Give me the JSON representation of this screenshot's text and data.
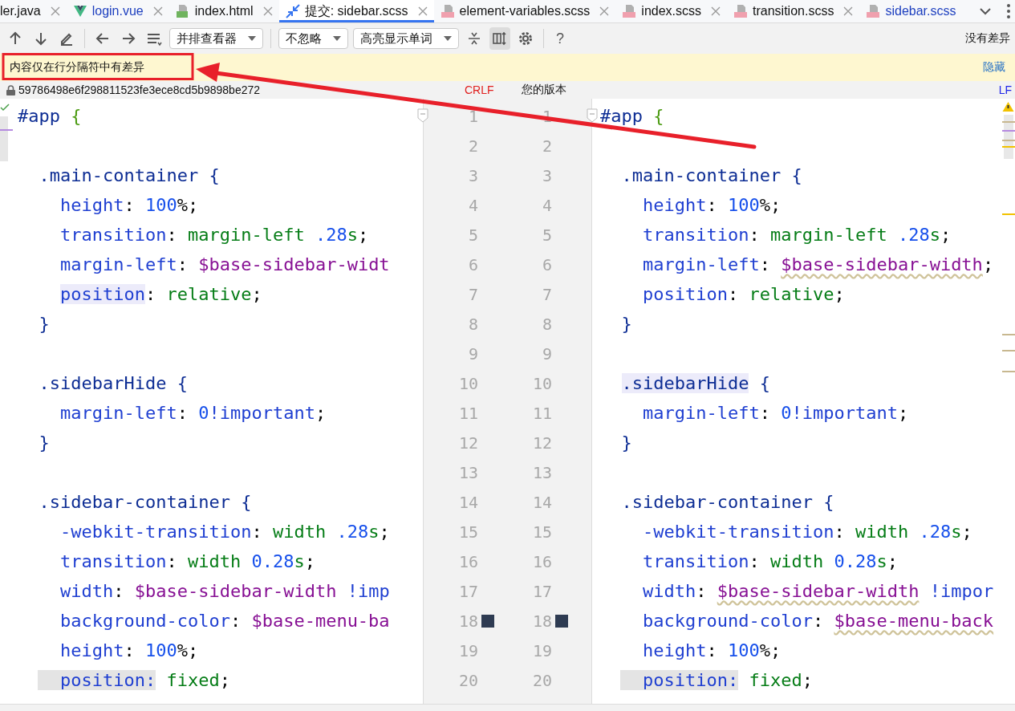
{
  "tabs": [
    {
      "label": "ler.java",
      "kind": "plain",
      "modified": false,
      "selected": false,
      "closable": true
    },
    {
      "label": "login.vue",
      "kind": "vue",
      "modified": true,
      "selected": false,
      "closable": true
    },
    {
      "label": "index.html",
      "kind": "html",
      "modified": false,
      "selected": false,
      "closable": true
    },
    {
      "label": "提交: sidebar.scss",
      "kind": "diff",
      "modified": false,
      "selected": true,
      "closable": true
    },
    {
      "label": "element-variables.scss",
      "kind": "sass",
      "modified": false,
      "selected": false,
      "closable": true
    },
    {
      "label": "index.scss",
      "kind": "sass",
      "modified": false,
      "selected": false,
      "closable": true
    },
    {
      "label": "transition.scss",
      "kind": "sass",
      "modified": false,
      "selected": false,
      "closable": true
    },
    {
      "label": "sidebar.scss",
      "kind": "sass",
      "modified": true,
      "selected": false,
      "closable": false
    }
  ],
  "toolbar": {
    "items": [
      {
        "kind": "up"
      },
      {
        "kind": "down"
      },
      {
        "kind": "edit"
      },
      {
        "kind": "separator"
      },
      {
        "kind": "back"
      },
      {
        "kind": "forward"
      },
      {
        "kind": "menu"
      },
      {
        "kind": "dropdown",
        "label": "并排查看器"
      },
      {
        "kind": "separator"
      },
      {
        "kind": "dropdown",
        "label": "不忽略"
      },
      {
        "kind": "dropdown",
        "label": "高亮显示单词"
      },
      {
        "kind": "collapse"
      },
      {
        "kind": "columns",
        "selected": true
      },
      {
        "kind": "settings"
      },
      {
        "kind": "separator"
      },
      {
        "kind": "help",
        "label": "?"
      }
    ],
    "status": "没有差异"
  },
  "notice": {
    "text": "内容仅在行分隔符中有差异",
    "hide_link": "隐藏"
  },
  "header": {
    "left_revision": "59786498e6f298811523fe3ece8cd5b9898be272",
    "left_separator": "CRLF",
    "right_title": "您的版本",
    "right_separator": "LF"
  },
  "lines": [
    {
      "left_number": "1",
      "right_number": "1",
      "kind": "top",
      "left": [
        {
          "t": "#app ",
          "kind": "sel"
        },
        {
          "t": "{",
          "kind": "brace"
        }
      ],
      "right": [
        {
          "t": "#app ",
          "kind": "sel"
        },
        {
          "t": "{",
          "kind": "brace"
        }
      ]
    },
    {
      "left_number": "2",
      "right_number": "2"
    },
    {
      "left_number": "3",
      "right_number": "3",
      "kind": "rule",
      "left": [
        {
          "t": ".main-container {",
          "kind": "sel"
        }
      ],
      "right": [
        {
          "t": ".main-container {",
          "kind": "sel"
        }
      ]
    },
    {
      "left_number": "4",
      "right_number": "4",
      "kind": "decl",
      "left": [
        {
          "t": "height",
          "kind": "prop"
        },
        {
          "t": ": ",
          "kind": "punct"
        },
        {
          "t": "100",
          "kind": "num"
        },
        {
          "t": "%;",
          "kind": "punct"
        }
      ],
      "right": [
        {
          "t": "height",
          "kind": "prop"
        },
        {
          "t": ": ",
          "kind": "punct"
        },
        {
          "t": "100",
          "kind": "num"
        },
        {
          "t": "%;",
          "kind": "punct"
        }
      ]
    },
    {
      "left_number": "5",
      "right_number": "5",
      "kind": "decl",
      "left": [
        {
          "t": "transition",
          "kind": "prop"
        },
        {
          "t": ": ",
          "kind": "punct"
        },
        {
          "t": "margin-left ",
          "kind": "val"
        },
        {
          "t": ".28",
          "kind": "num"
        },
        {
          "t": "s",
          "kind": "val"
        },
        {
          "t": ";",
          "kind": "punct"
        }
      ],
      "right": [
        {
          "t": "transition",
          "kind": "prop"
        },
        {
          "t": ": ",
          "kind": "punct"
        },
        {
          "t": "margin-left ",
          "kind": "val"
        },
        {
          "t": ".28",
          "kind": "num"
        },
        {
          "t": "s",
          "kind": "val"
        },
        {
          "t": ";",
          "kind": "punct"
        }
      ]
    },
    {
      "left_number": "6",
      "right_number": "6",
      "kind": "decl",
      "left": [
        {
          "t": "margin-left",
          "kind": "prop"
        },
        {
          "t": ": ",
          "kind": "punct"
        },
        {
          "t": "$base-sidebar-widt",
          "kind": "var"
        }
      ],
      "right": [
        {
          "t": "margin-left",
          "kind": "prop"
        },
        {
          "t": ": ",
          "kind": "punct"
        },
        {
          "t": "$base-sidebar-width",
          "kind": "var-warn"
        },
        {
          "t": ";",
          "kind": "punct"
        }
      ]
    },
    {
      "left_number": "7",
      "right_number": "7",
      "kind": "decl",
      "left": [
        {
          "t": "position",
          "kind": "prop-caret"
        },
        {
          "t": ": ",
          "kind": "punct"
        },
        {
          "t": "relative",
          "kind": "val"
        },
        {
          "t": ";",
          "kind": "punct"
        }
      ],
      "right": [
        {
          "t": "position",
          "kind": "prop"
        },
        {
          "t": ": ",
          "kind": "punct"
        },
        {
          "t": "relative",
          "kind": "val"
        },
        {
          "t": ";",
          "kind": "punct"
        }
      ]
    },
    {
      "left_number": "8",
      "right_number": "8",
      "kind": "rule",
      "left": [
        {
          "t": "}",
          "kind": "sel"
        }
      ],
      "right": [
        {
          "t": "}",
          "kind": "sel"
        }
      ]
    },
    {
      "left_number": "9",
      "right_number": "9"
    },
    {
      "left_number": "10",
      "right_number": "10",
      "kind": "rule",
      "left": [
        {
          "t": ".sidebarHide {",
          "kind": "sel"
        }
      ],
      "right": [
        {
          "t": ".sidebarHide",
          "kind": "sel-caret"
        },
        {
          "t": " {",
          "kind": "sel"
        }
      ]
    },
    {
      "left_number": "11",
      "right_number": "11",
      "kind": "decl",
      "left": [
        {
          "t": "margin-left",
          "kind": "prop"
        },
        {
          "t": ": ",
          "kind": "punct"
        },
        {
          "t": "0",
          "kind": "num"
        },
        {
          "t": "!important",
          "kind": "prop"
        },
        {
          "t": ";",
          "kind": "punct"
        }
      ],
      "right": [
        {
          "t": "margin-left",
          "kind": "prop"
        },
        {
          "t": ": ",
          "kind": "punct"
        },
        {
          "t": "0",
          "kind": "num"
        },
        {
          "t": "!important",
          "kind": "prop"
        },
        {
          "t": ";",
          "kind": "punct"
        }
      ]
    },
    {
      "left_number": "12",
      "right_number": "12",
      "kind": "rule",
      "left": [
        {
          "t": "}",
          "kind": "sel"
        }
      ],
      "right": [
        {
          "t": "}",
          "kind": "sel"
        }
      ]
    },
    {
      "left_number": "13",
      "right_number": "13"
    },
    {
      "left_number": "14",
      "right_number": "14",
      "kind": "rule",
      "left": [
        {
          "t": ".sidebar-container {",
          "kind": "sel"
        }
      ],
      "right": [
        {
          "t": ".sidebar-container {",
          "kind": "sel"
        }
      ]
    },
    {
      "left_number": "15",
      "right_number": "15",
      "kind": "decl",
      "left": [
        {
          "t": "-webkit-transition",
          "kind": "prop"
        },
        {
          "t": ": ",
          "kind": "punct"
        },
        {
          "t": "width ",
          "kind": "val"
        },
        {
          "t": ".28",
          "kind": "num"
        },
        {
          "t": "s",
          "kind": "val"
        },
        {
          "t": ";",
          "kind": "punct"
        }
      ],
      "right": [
        {
          "t": "-webkit-transition",
          "kind": "prop"
        },
        {
          "t": ": ",
          "kind": "punct"
        },
        {
          "t": "width ",
          "kind": "val"
        },
        {
          "t": ".28",
          "kind": "num"
        },
        {
          "t": "s",
          "kind": "val"
        },
        {
          "t": ";",
          "kind": "punct"
        }
      ]
    },
    {
      "left_number": "16",
      "right_number": "16",
      "kind": "decl",
      "left": [
        {
          "t": "transition",
          "kind": "prop"
        },
        {
          "t": ": ",
          "kind": "punct"
        },
        {
          "t": "width ",
          "kind": "val"
        },
        {
          "t": "0.28",
          "kind": "num"
        },
        {
          "t": "s",
          "kind": "val"
        },
        {
          "t": ";",
          "kind": "punct"
        }
      ],
      "right": [
        {
          "t": "transition",
          "kind": "prop"
        },
        {
          "t": ": ",
          "kind": "punct"
        },
        {
          "t": "width ",
          "kind": "val"
        },
        {
          "t": "0.28",
          "kind": "num"
        },
        {
          "t": "s",
          "kind": "val"
        },
        {
          "t": ";",
          "kind": "punct"
        }
      ]
    },
    {
      "left_number": "17",
      "right_number": "17",
      "kind": "decl",
      "left": [
        {
          "t": "width",
          "kind": "prop"
        },
        {
          "t": ": ",
          "kind": "punct"
        },
        {
          "t": "$base-sidebar-width",
          "kind": "var"
        },
        {
          "t": " !imp",
          "kind": "prop"
        }
      ],
      "right": [
        {
          "t": "width",
          "kind": "prop"
        },
        {
          "t": ": ",
          "kind": "punct"
        },
        {
          "t": "$base-sidebar-width",
          "kind": "var-warn"
        },
        {
          "t": " !impor",
          "kind": "prop"
        }
      ]
    },
    {
      "left_number": "18",
      "right_number": "18",
      "kind": "decl",
      "color": "#2e3b52",
      "left": [
        {
          "t": "background-color",
          "kind": "prop"
        },
        {
          "t": ": ",
          "kind": "punct"
        },
        {
          "t": "$base-menu-ba",
          "kind": "var"
        }
      ],
      "right": [
        {
          "t": "background-color",
          "kind": "prop"
        },
        {
          "t": ": ",
          "kind": "punct"
        },
        {
          "t": "$base-menu-back",
          "kind": "var-warn"
        }
      ]
    },
    {
      "left_number": "19",
      "right_number": "19",
      "kind": "decl",
      "left": [
        {
          "t": "height",
          "kind": "prop"
        },
        {
          "t": ": ",
          "kind": "punct"
        },
        {
          "t": "100",
          "kind": "num"
        },
        {
          "t": "%;",
          "kind": "punct"
        }
      ],
      "right": [
        {
          "t": "height",
          "kind": "prop"
        },
        {
          "t": ": ",
          "kind": "punct"
        },
        {
          "t": "100",
          "kind": "num"
        },
        {
          "t": "%;",
          "kind": "punct"
        }
      ]
    },
    {
      "left_number": "20",
      "right_number": "20",
      "kind": "decl",
      "left": [
        {
          "t": "position:",
          "kind": "prop-sel"
        },
        {
          "t": " fixed",
          "kind": "val"
        },
        {
          "t": ";",
          "kind": "punct"
        }
      ],
      "right": [
        {
          "t": "position:",
          "kind": "prop-sel"
        },
        {
          "t": " fixed",
          "kind": "val"
        },
        {
          "t": ";",
          "kind": "punct"
        }
      ]
    }
  ]
}
